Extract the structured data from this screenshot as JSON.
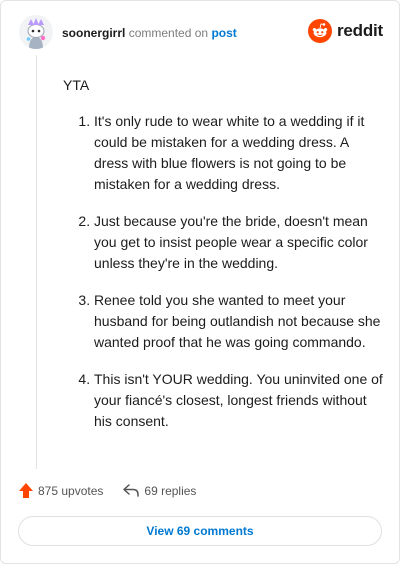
{
  "header": {
    "username": "soonergirrl",
    "action": "commented on",
    "link": "post",
    "brand": "reddit"
  },
  "comment": {
    "intro": "YTA",
    "points": [
      "It's only rude to wear white to a wedding if it could be mistaken for a wedding dress. A dress with blue flowers is not going to be mistaken for a wedding dress.",
      "Just because you're the bride, doesn't mean you get to insist people wear a specific color unless they're in the wedding.",
      "Renee told you she wanted to meet your husband for being outlandish not because she wanted proof that he was going commando.",
      "This isn't YOUR wedding. You uninvited one of your fiancé's closest, longest friends without his consent."
    ]
  },
  "stats": {
    "upvotes": "875 upvotes",
    "replies": "69 replies"
  },
  "footer": {
    "view_comments": "View 69 comments"
  },
  "colors": {
    "accent": "#0079d3",
    "upvote": "#ff4500",
    "reddit_orange": "#ff4500"
  },
  "icons": [
    "snoo-avatar-icon",
    "reddit-logo-icon",
    "upvote-arrow-icon",
    "reply-arrow-icon"
  ]
}
